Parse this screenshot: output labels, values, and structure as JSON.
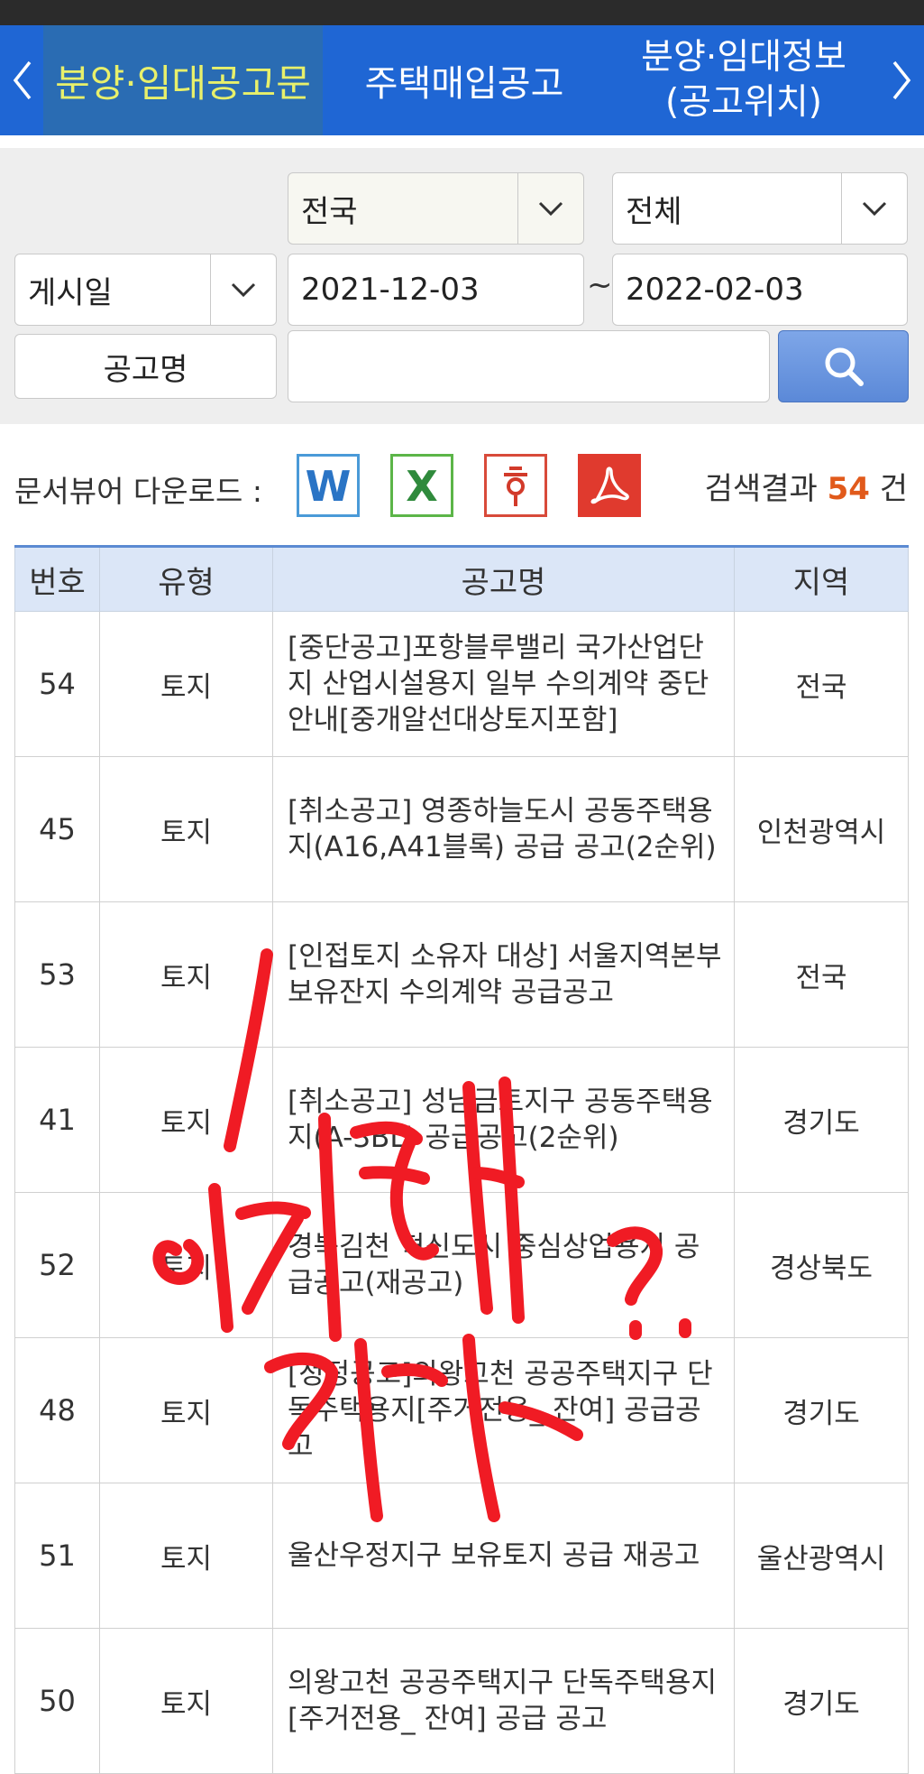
{
  "nav": {
    "prev_label": "‹",
    "next_label": "›",
    "tabs": [
      {
        "label": "분양·임대공고문",
        "active": true
      },
      {
        "label": "주택매입공고",
        "active": false
      },
      {
        "label_line1": "분양·임대정보",
        "label_line2": "(공고위치)",
        "active": false
      }
    ]
  },
  "search": {
    "region_select": "전국",
    "type_select": "전체",
    "date_type_select": "게시일",
    "date_from": "2021-12-03",
    "date_separator": "~",
    "date_to": "2022-02-03",
    "name_label": "공고명",
    "name_value": ""
  },
  "viewer": {
    "label": "문서뷰어 다운로드 :",
    "icons": [
      "word-icon",
      "excel-icon",
      "hwp-icon",
      "pdf-icon"
    ],
    "result_prefix": "검색결과",
    "result_count": "54",
    "result_suffix": "건"
  },
  "table": {
    "headers": [
      "번호",
      "유형",
      "공고명",
      "지역"
    ],
    "rows": [
      {
        "no": "54",
        "type": "토지",
        "title": "[중단공고]포항블루밸리 국가산업단지 산업시설용지 일부 수의계약 중단 안내[중개알선대상토지포함]",
        "region": "전국"
      },
      {
        "no": "45",
        "type": "토지",
        "title": "[취소공고] 영종하늘도시 공동주택용지(A16,A41블록) 공급 공고(2순위)",
        "region": "인천광역시"
      },
      {
        "no": "53",
        "type": "토지",
        "title": "[인접토지 소유자 대상] 서울지역본부 보유잔지 수의계약 공급공고",
        "region": "전국"
      },
      {
        "no": "41",
        "type": "토지",
        "title": "[취소공고] 성남금토지구 공동주택용지(A-3BL) 공급공고(2순위)",
        "region": "경기도"
      },
      {
        "no": "52",
        "type": "토지",
        "title": "경북김천 혁신도시 중심상업용지 공급공고(재공고)",
        "region": "경상북도"
      },
      {
        "no": "48",
        "type": "토지",
        "title": "[정정공고]의왕고천 공공주택지구 단독주택용지[주거전용_ 잔여] 공급공고",
        "region": "경기도"
      },
      {
        "no": "51",
        "type": "토지",
        "title": "울산우정지구 보유토지 공급 재공고",
        "region": "울산광역시"
      },
      {
        "no": "50",
        "type": "토지",
        "title": "의왕고천 공공주택지구 단독주택용지[주거전용_ 잔여] 공급 공고",
        "region": "경기도"
      }
    ]
  },
  "colors": {
    "nav_bg": "#1f66d4",
    "active_tab_bg": "#2a6cb3",
    "active_tab_text": "#e8f06b",
    "count_color": "#e15a1b",
    "scribble": "#f01b24"
  }
}
